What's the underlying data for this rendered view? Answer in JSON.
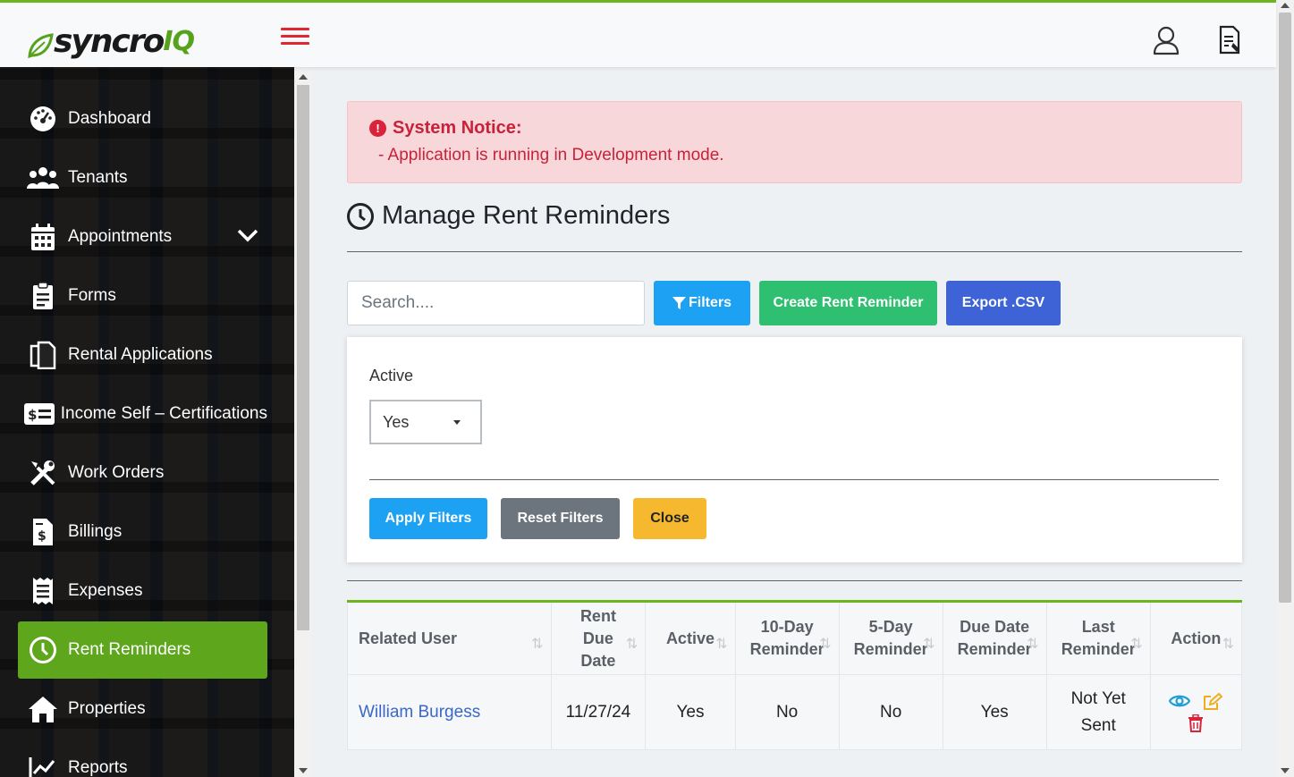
{
  "header": {
    "logo_main": "syncro",
    "logo_suffix": "IQ",
    "colors": {
      "accent": "#6cb51e",
      "hamburger": "#e0262e"
    }
  },
  "sidebar": {
    "items": [
      {
        "label": "Dashboard",
        "icon": "dashboard-gauge-icon"
      },
      {
        "label": "Tenants",
        "icon": "users-icon"
      },
      {
        "label": "Appointments",
        "icon": "calendar-icon",
        "has_submenu": true
      },
      {
        "label": "Forms",
        "icon": "clipboard-icon"
      },
      {
        "label": "Rental Applications",
        "icon": "copy-documents-icon"
      },
      {
        "label": "Income Self – Certifications",
        "icon": "money-card-icon"
      },
      {
        "label": "Work Orders",
        "icon": "tools-icon"
      },
      {
        "label": "Billings",
        "icon": "invoice-dollar-icon"
      },
      {
        "label": "Expenses",
        "icon": "receipt-icon"
      },
      {
        "label": "Rent Reminders",
        "icon": "clock-icon",
        "active": true
      },
      {
        "label": "Properties",
        "icon": "home-icon"
      },
      {
        "label": "Reports",
        "icon": "chart-line-icon"
      }
    ],
    "active_color": "#5ea61c"
  },
  "notice": {
    "title": "System Notice:",
    "message": "- Application is running in Development mode."
  },
  "page": {
    "title": "Manage Rent Reminders"
  },
  "toolbar": {
    "search_placeholder": "Search....",
    "filters_label": "Filters",
    "create_label": "Create Rent Reminder",
    "export_label": "Export .CSV"
  },
  "filters": {
    "active_label": "Active",
    "active_value": "Yes",
    "apply_label": "Apply Filters",
    "reset_label": "Reset Filters",
    "close_label": "Close"
  },
  "table": {
    "columns": [
      {
        "line1": "Related User",
        "line2": ""
      },
      {
        "line1": "Rent Due",
        "line2": "Date"
      },
      {
        "line1": "Active",
        "line2": ""
      },
      {
        "line1": "10-Day",
        "line2": "Reminder"
      },
      {
        "line1": "5-Day",
        "line2": "Reminder"
      },
      {
        "line1": "Due Date",
        "line2": "Reminder"
      },
      {
        "line1": "Last",
        "line2": "Reminder"
      },
      {
        "line1": "Action",
        "line2": ""
      }
    ],
    "rows": [
      {
        "related_user": "William Burgess",
        "rent_due_date": "11/27/24",
        "active": "Yes",
        "ten_day": "No",
        "five_day": "No",
        "due_date": "Yes",
        "last_line1": "Not Yet",
        "last_line2": "Sent"
      }
    ]
  }
}
